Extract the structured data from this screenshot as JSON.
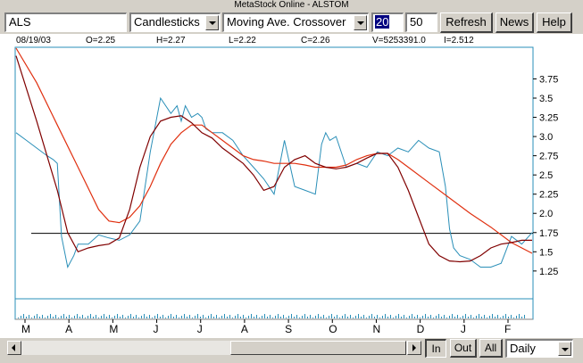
{
  "window": {
    "title": "MetaStock Online - ALSTOM"
  },
  "toolbar": {
    "symbol": "ALS",
    "chart_type": "Candlesticks",
    "indicator": "Moving Ave. Crossover",
    "period_short": "20",
    "period_long": "50",
    "refresh_label": "Refresh",
    "news_label": "News",
    "help_label": "Help"
  },
  "info": {
    "date": "08/19/03",
    "open": "O=2.25",
    "high": "H=2.27",
    "low": "L=2.22",
    "close": "C=2.26",
    "volume": "V=5253391.0",
    "indicator": "I=2.512"
  },
  "bottom": {
    "zoom_in": "In",
    "zoom_out": "Out",
    "all": "All",
    "interval": "Daily"
  },
  "colors": {
    "price": "#2a8fb8",
    "ma_short": "#800000",
    "ma_long": "#e03010",
    "hline": "#000000"
  },
  "chart_data": {
    "type": "line",
    "x_tick_labels": [
      "M",
      "A",
      "M",
      "J",
      "J",
      "A",
      "S",
      "O",
      "N",
      "D",
      "J",
      "F"
    ],
    "y_tick_labels": [
      "3.75",
      "3.5",
      "3.25",
      "3.0",
      "2.75",
      "2.5",
      "2.25",
      "2.0",
      "1.75",
      "1.5",
      "1.25"
    ],
    "ylim": [
      0.9,
      4.15
    ],
    "horizontal_line": 1.74,
    "x_index_range": [
      0,
      250
    ],
    "series": [
      {
        "role": "price",
        "x": [
          0,
          5,
          10,
          15,
          18,
          20,
          22,
          25,
          28,
          30,
          35,
          40,
          45,
          50,
          55,
          60,
          65,
          70,
          75,
          78,
          80,
          82,
          85,
          88,
          90,
          92,
          95,
          100,
          105,
          110,
          115,
          120,
          125,
          130,
          135,
          140,
          145,
          148,
          150,
          152,
          155,
          160,
          165,
          170,
          175,
          180,
          185,
          190,
          195,
          200,
          205,
          208,
          210,
          212,
          215,
          220,
          225,
          230,
          235,
          240,
          245,
          250
        ],
        "y": [
          3.05,
          2.95,
          2.85,
          2.75,
          2.7,
          2.65,
          1.7,
          1.3,
          1.45,
          1.6,
          1.6,
          1.72,
          1.68,
          1.65,
          1.72,
          1.9,
          2.8,
          3.5,
          3.3,
          3.4,
          3.2,
          3.4,
          3.25,
          3.3,
          3.25,
          3.1,
          3.05,
          3.05,
          2.95,
          2.75,
          2.6,
          2.45,
          2.25,
          2.95,
          2.35,
          2.3,
          2.25,
          2.9,
          3.05,
          2.95,
          3.0,
          2.6,
          2.65,
          2.6,
          2.8,
          2.75,
          2.85,
          2.8,
          2.95,
          2.85,
          2.8,
          2.35,
          1.8,
          1.55,
          1.45,
          1.4,
          1.3,
          1.3,
          1.35,
          1.7,
          1.6,
          1.75
        ]
      },
      {
        "role": "ma_short",
        "x": [
          0,
          10,
          20,
          25,
          30,
          35,
          40,
          45,
          50,
          55,
          60,
          65,
          70,
          75,
          80,
          85,
          90,
          95,
          100,
          105,
          110,
          115,
          120,
          125,
          130,
          135,
          140,
          145,
          150,
          155,
          160,
          165,
          170,
          175,
          180,
          185,
          190,
          195,
          200,
          205,
          210,
          215,
          220,
          225,
          230,
          235,
          240,
          245,
          250
        ],
        "y": [
          4.05,
          3.2,
          2.3,
          1.75,
          1.5,
          1.55,
          1.58,
          1.6,
          1.68,
          2.05,
          2.6,
          3.0,
          3.2,
          3.25,
          3.27,
          3.18,
          3.05,
          2.98,
          2.85,
          2.75,
          2.65,
          2.5,
          2.3,
          2.35,
          2.6,
          2.7,
          2.75,
          2.65,
          2.6,
          2.58,
          2.6,
          2.65,
          2.72,
          2.78,
          2.78,
          2.6,
          2.3,
          1.95,
          1.6,
          1.45,
          1.38,
          1.37,
          1.38,
          1.45,
          1.55,
          1.6,
          1.62,
          1.65,
          1.65
        ]
      },
      {
        "role": "ma_long",
        "x": [
          0,
          10,
          20,
          30,
          40,
          45,
          50,
          55,
          60,
          65,
          70,
          75,
          80,
          85,
          90,
          95,
          100,
          105,
          110,
          115,
          120,
          125,
          130,
          135,
          140,
          145,
          150,
          155,
          160,
          165,
          170,
          175,
          180,
          185,
          190,
          200,
          210,
          220,
          230,
          240,
          250
        ],
        "y": [
          4.25,
          3.7,
          3.15,
          2.6,
          2.05,
          1.9,
          1.88,
          1.95,
          2.1,
          2.35,
          2.65,
          2.9,
          3.05,
          3.15,
          3.15,
          3.05,
          2.95,
          2.85,
          2.75,
          2.7,
          2.68,
          2.65,
          2.65,
          2.65,
          2.63,
          2.6,
          2.6,
          2.6,
          2.63,
          2.7,
          2.75,
          2.78,
          2.78,
          2.7,
          2.6,
          2.4,
          2.2,
          2.0,
          1.82,
          1.62,
          1.48
        ]
      }
    ]
  }
}
